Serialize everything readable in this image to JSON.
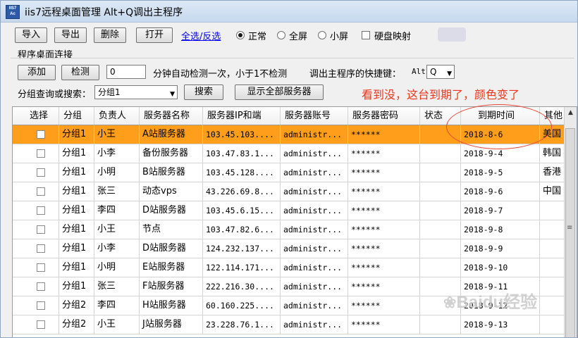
{
  "window": {
    "title": "iis7远程桌面管理 Alt+Q调出主程序",
    "icon_label_top": "IIS7",
    "icon_label_bottom": "Ac"
  },
  "toolbar": {
    "import_label": "导入",
    "export_label": "导出",
    "delete_label": "删除",
    "open_label": "打开",
    "select_toggle_link": "全选/反选",
    "mode_options": [
      {
        "label": "正常",
        "selected": true
      },
      {
        "label": "全屏",
        "selected": false
      },
      {
        "label": "小屏",
        "selected": false
      }
    ],
    "disk_map_label": "硬盘映射"
  },
  "connection": {
    "group_title": "程序桌面连接",
    "add_label": "添加",
    "check_label": "检测",
    "interval_value": "0",
    "interval_desc": "分钟自动检测一次，小于1不检测",
    "hotkey_label": "调出主程序的快捷键：",
    "hotkey_prefix": "Alt",
    "hotkey_value": "Q",
    "query_label": "分组查询或搜索：",
    "query_value": "分组1",
    "search_label": "搜索",
    "show_all_label": "显示全部服务器"
  },
  "annotation_text": "看到没，这台到期了，颜色变了",
  "table": {
    "columns": [
      "选择",
      "分组",
      "负责人",
      "服务器名称",
      "服务器IP和端",
      "服务器账号",
      "服务器密码",
      "状态",
      "到期时间",
      "其他"
    ],
    "rows": [
      {
        "group": "分组1",
        "owner": "小王",
        "name": "A站服务器",
        "ip": "103.45.103....",
        "account": "administr...",
        "password": "******",
        "status": "",
        "expire": "2018-8-6",
        "other": "美国",
        "expired": true
      },
      {
        "group": "分组1",
        "owner": "小李",
        "name": "备份服务器",
        "ip": "103.47.83.1...",
        "account": "administr...",
        "password": "******",
        "status": "",
        "expire": "2018-9-4",
        "other": "韩国",
        "expired": false
      },
      {
        "group": "分组1",
        "owner": "小明",
        "name": "B站服务器",
        "ip": "103.45.128....",
        "account": "administr...",
        "password": "******",
        "status": "",
        "expire": "2018-9-5",
        "other": "香港",
        "expired": false
      },
      {
        "group": "分组1",
        "owner": "张三",
        "name": "动态vps",
        "ip": "43.226.69.8...",
        "account": "administr...",
        "password": "******",
        "status": "",
        "expire": "2018-9-6",
        "other": "中国",
        "expired": false
      },
      {
        "group": "分组1",
        "owner": "李四",
        "name": "D站服务器",
        "ip": "103.45.6.15...",
        "account": "administr...",
        "password": "******",
        "status": "",
        "expire": "2018-9-7",
        "other": "",
        "expired": false
      },
      {
        "group": "分组1",
        "owner": "小王",
        "name": "节点",
        "ip": "103.47.82.6...",
        "account": "administr...",
        "password": "******",
        "status": "",
        "expire": "2018-9-8",
        "other": "",
        "expired": false
      },
      {
        "group": "分组1",
        "owner": "小李",
        "name": "D站服务器",
        "ip": "124.232.137...",
        "account": "administr...",
        "password": "******",
        "status": "",
        "expire": "2018-9-9",
        "other": "",
        "expired": false
      },
      {
        "group": "分组1",
        "owner": "小明",
        "name": "E站服务器",
        "ip": "122.114.171...",
        "account": "administr...",
        "password": "******",
        "status": "",
        "expire": "2018-9-10",
        "other": "",
        "expired": false
      },
      {
        "group": "分组1",
        "owner": "张三",
        "name": "F站服务器",
        "ip": "222.216.30....",
        "account": "administr...",
        "password": "******",
        "status": "",
        "expire": "2018-9-11",
        "other": "",
        "expired": false
      },
      {
        "group": "分组2",
        "owner": "李四",
        "name": "H站服务器",
        "ip": "60.160.225....",
        "account": "administr...",
        "password": "******",
        "status": "",
        "expire": "2018-9-12",
        "other": "",
        "expired": false
      },
      {
        "group": "分组2",
        "owner": "小王",
        "name": "J站服务器",
        "ip": "23.228.76.1...",
        "account": "administr...",
        "password": "******",
        "status": "",
        "expire": "2018-9-13",
        "other": "",
        "expired": false
      }
    ]
  },
  "watermark": "Baidu经验",
  "colors": {
    "expired_row": "#ff9e1b",
    "annotation": "#e8381e",
    "link": "#0000ee"
  }
}
